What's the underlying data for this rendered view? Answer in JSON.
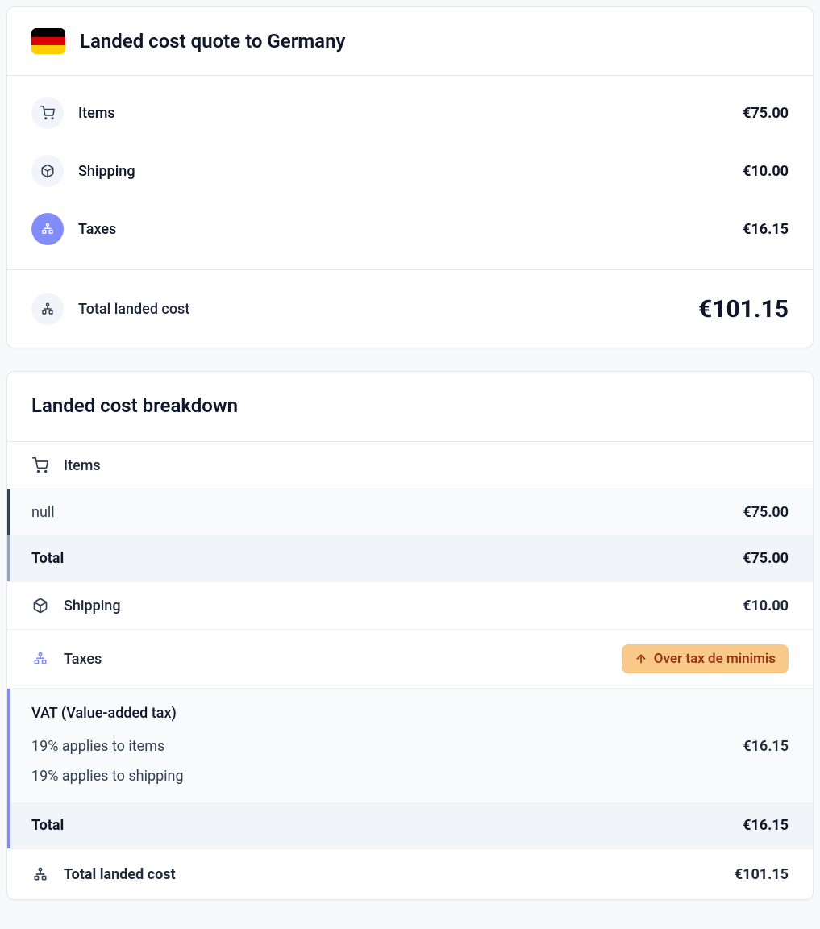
{
  "quote": {
    "title": "Landed cost quote to Germany",
    "country": "Germany",
    "flag_colors": {
      "top": "#000000",
      "middle": "#dd0000",
      "bottom": "#ffce00"
    },
    "rows": {
      "items": {
        "label": "Items",
        "value": "€75.00"
      },
      "shipping": {
        "label": "Shipping",
        "value": "€10.00"
      },
      "taxes": {
        "label": "Taxes",
        "value": "€16.15"
      }
    },
    "total": {
      "label": "Total landed cost",
      "value": "€101.15"
    }
  },
  "breakdown": {
    "title": "Landed cost breakdown",
    "items_section": {
      "header": "Items",
      "lines": [
        {
          "label": "null",
          "value": "€75.00"
        }
      ],
      "total": {
        "label": "Total",
        "value": "€75.00"
      }
    },
    "shipping_section": {
      "header": "Shipping",
      "value": "€10.00"
    },
    "taxes_section": {
      "header": "Taxes",
      "badge": "Over tax de minimis",
      "vat_title": "VAT (Value-added tax)",
      "lines": [
        {
          "label": "19% applies to items",
          "value": "€16.15"
        },
        {
          "label": "19% applies to shipping",
          "value": ""
        }
      ],
      "total": {
        "label": "Total",
        "value": "€16.15"
      }
    },
    "grand_total": {
      "label": "Total landed cost",
      "value": "€101.15"
    }
  }
}
